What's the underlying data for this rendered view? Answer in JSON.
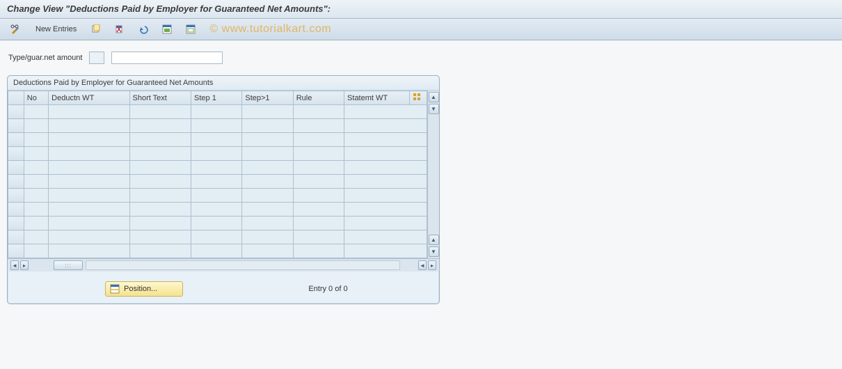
{
  "header": {
    "title": "Change View \"Deductions Paid by Employer for Guaranteed Net Amounts\":"
  },
  "toolbar": {
    "new_entries_label": "New Entries"
  },
  "watermark": "© www.tutorialkart.com",
  "field": {
    "label": "Type/guar.net amount",
    "code_value": "",
    "desc_value": ""
  },
  "group": {
    "title": "Deductions Paid by Employer for Guaranteed Net Amounts",
    "columns": {
      "no": "No",
      "deductn_wt": "Deductn WT",
      "short_text": "Short Text",
      "step1": "Step 1",
      "stepg1": "Step>1",
      "rule": "Rule",
      "statemt_wt": "Statemt WT"
    },
    "row_count": 11
  },
  "footer": {
    "position_label": "Position...",
    "entry_text": "Entry 0 of 0"
  }
}
